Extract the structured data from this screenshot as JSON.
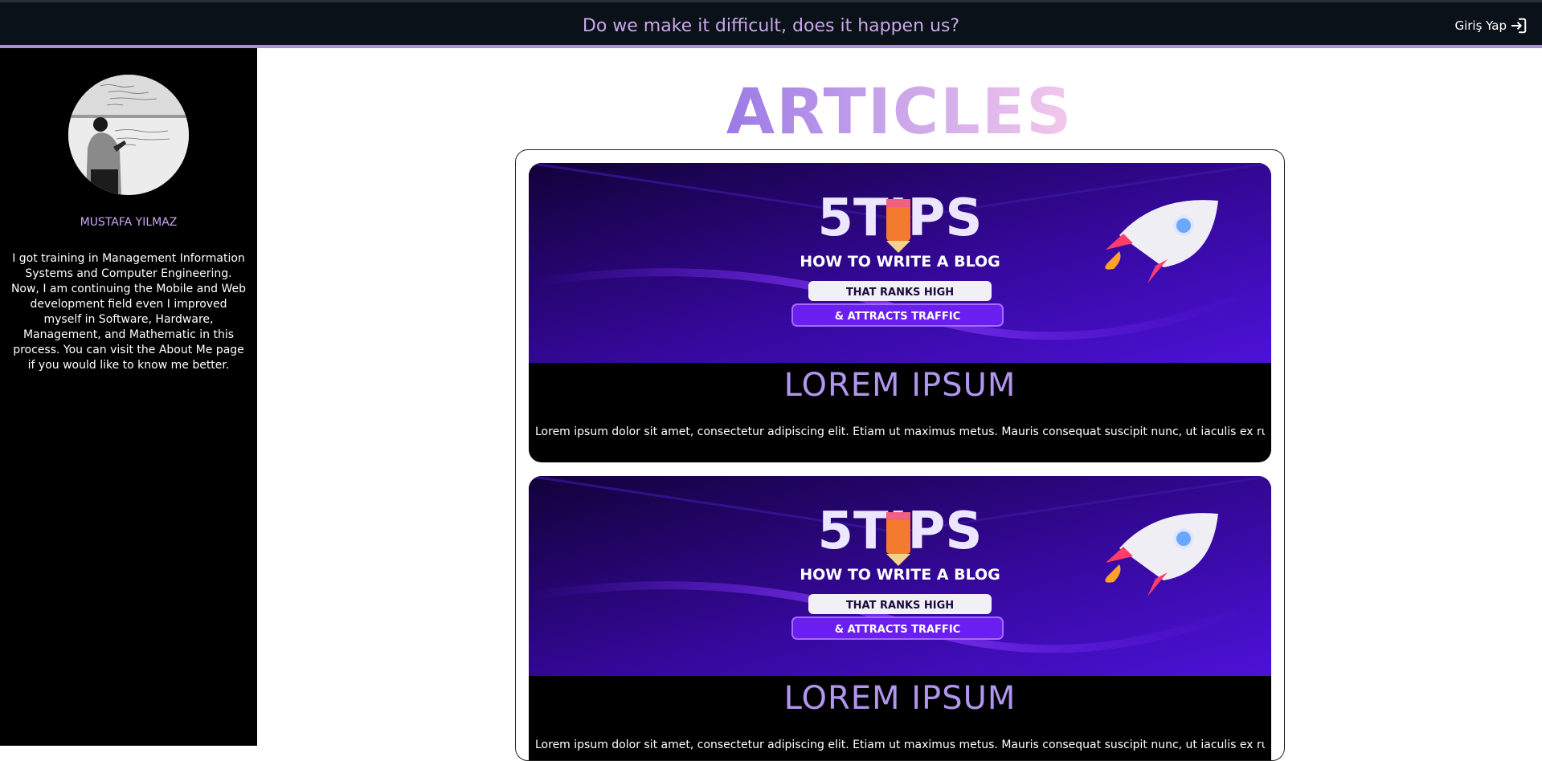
{
  "header": {
    "slogan": "Do we make it difficult, does it happen us?",
    "login_label": "Giriş Yap",
    "login_icon": "sign-in-icon"
  },
  "sidebar": {
    "author_name": "MUSTAFA YILMAZ",
    "bio": "I got training in Management Information Systems and Computer Engineering. Now, I am continuing the Mobile and Web development field even I improved myself in Software, Hardware, Management, and Mathematic in this process. You can visit the About Me page if you would like to know me better."
  },
  "main": {
    "heading": "ARTICLES",
    "articles": [
      {
        "banner": {
          "headline": "5TIPS",
          "line1": "HOW TO WRITE A BLOG",
          "tag1": "THAT RANKS HIGH",
          "tag2": "& ATTRACTS TRAFFIC"
        },
        "title": "LOREM IPSUM",
        "excerpt": "Lorem ipsum dolor sit amet, consectetur adipiscing elit. Etiam ut maximus metus. Mauris consequat suscipit nunc, ut iaculis ex rutrum ..."
      },
      {
        "banner": {
          "headline": "5TIPS",
          "line1": "HOW TO WRITE A BLOG",
          "tag1": "THAT RANKS HIGH",
          "tag2": "& ATTRACTS TRAFFIC"
        },
        "title": "LOREM IPSUM",
        "excerpt": "Lorem ipsum dolor sit amet, consectetur adipiscing elit. Etiam ut maximus metus. Mauris consequat suscipit nunc, ut iaculis ex rutrum ..."
      }
    ]
  },
  "colors": {
    "accent": "#a88de6",
    "topbar": "#0a1118",
    "title_purple": "#b196ee"
  }
}
